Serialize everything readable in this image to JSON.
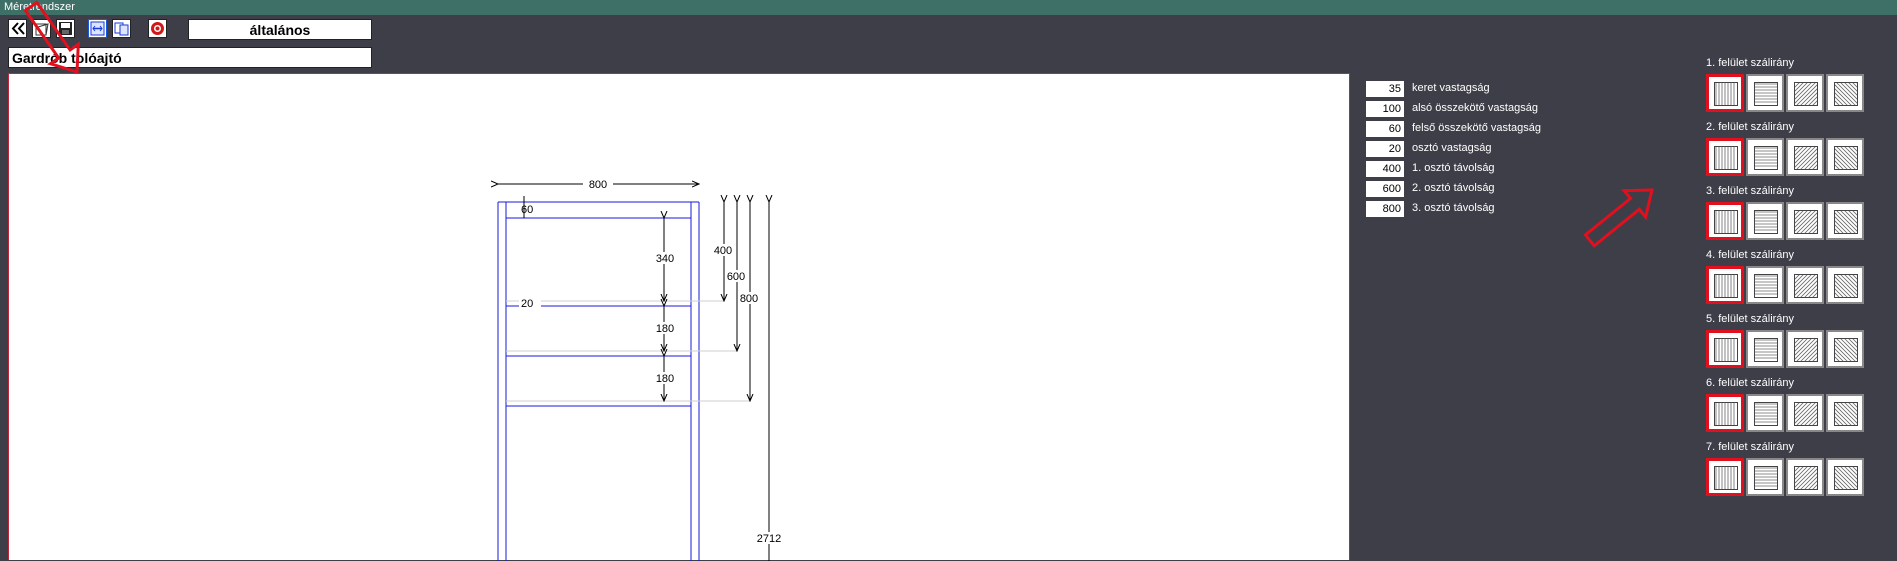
{
  "window": {
    "title": "Méretrendszer"
  },
  "toolbar": {
    "buttons": [
      {
        "name": "back-icon"
      },
      {
        "name": "open-icon"
      },
      {
        "name": "save-icon"
      },
      {
        "name": "fit-width-icon"
      },
      {
        "name": "copy-icon"
      },
      {
        "name": "close-icon"
      }
    ],
    "category": "általános"
  },
  "product": {
    "name": "Gardrób tolóajtó"
  },
  "parameters": [
    {
      "value": "35",
      "label": "keret vastagság"
    },
    {
      "value": "100",
      "label": "alsó összekötő vastagság"
    },
    {
      "value": "60",
      "label": "felső összekötő vastagság"
    },
    {
      "value": "20",
      "label": "osztó vastagság"
    },
    {
      "value": "400",
      "label": "1. osztó távolság"
    },
    {
      "value": "600",
      "label": "2. osztó távolság"
    },
    {
      "value": "800",
      "label": "3. osztó távolság"
    }
  ],
  "grain_groups": [
    {
      "title": "1. felület szálirány",
      "selected": 0
    },
    {
      "title": "2. felület szálirány",
      "selected": 0
    },
    {
      "title": "3. felület szálirány",
      "selected": 0
    },
    {
      "title": "4. felület szálirány",
      "selected": 0
    },
    {
      "title": "5. felület szálirány",
      "selected": 0
    },
    {
      "title": "6. felület szálirány",
      "selected": 0
    },
    {
      "title": "7. felület szálirány",
      "selected": 0
    }
  ],
  "grain_options": [
    "vertical-grain-icon",
    "horizontal-grain-icon",
    "diagonal-right-grain-icon",
    "diagonal-left-grain-icon"
  ],
  "drawing": {
    "width_dim": "800",
    "top_rail_dim": "60",
    "gap1_dim": "340",
    "divider_dim": "20",
    "gap2_dim": "180",
    "gap3_dim": "180",
    "dist1_dim": "400",
    "dist2_dim": "600",
    "dist3_dim": "800",
    "height_dim": "2712"
  },
  "colors": {
    "titlebar": "#3f7068",
    "background": "#3e3e48",
    "selection": "#e0101e",
    "drawing_line": "#1a1ad8",
    "annotation_arrow": "#e0101e"
  }
}
